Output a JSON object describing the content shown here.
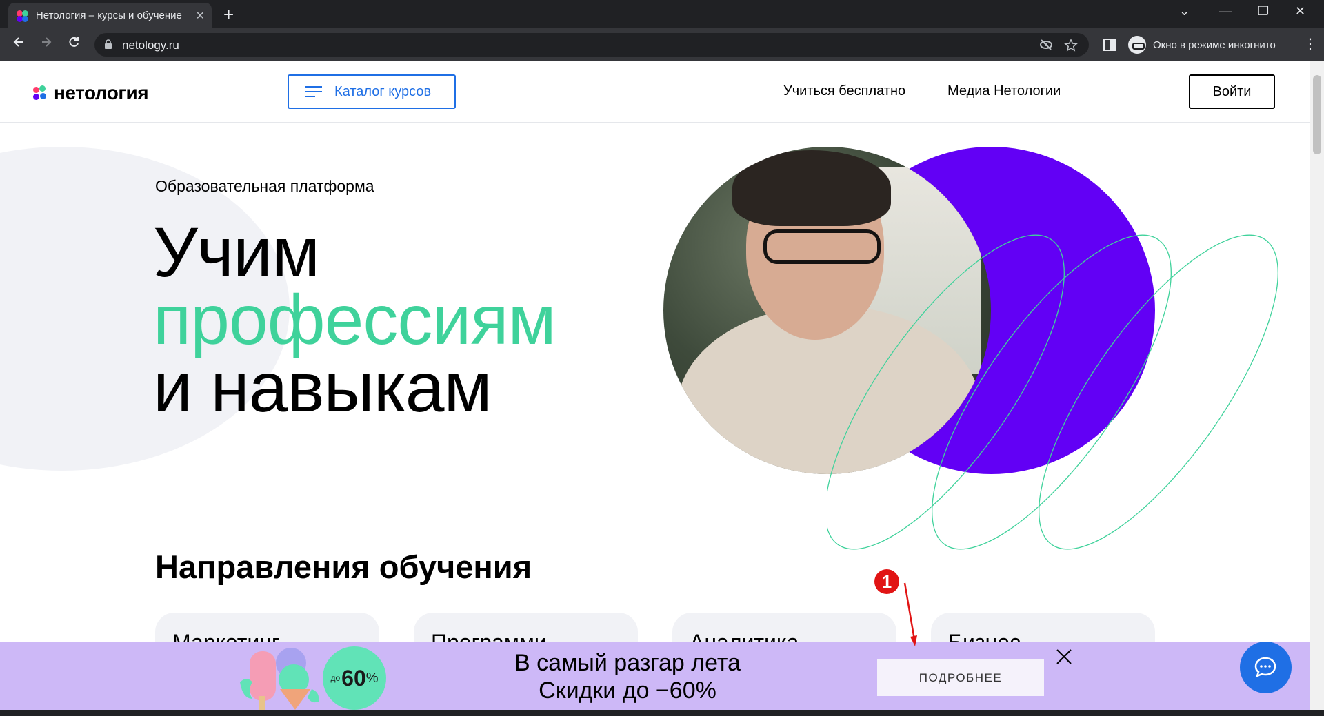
{
  "browser": {
    "tab_title": "Нетология – курсы и обучение",
    "tab_close": "✕",
    "new_tab": "+",
    "url": "netology.ru",
    "incognito_label": "Окно в режиме инкогнито",
    "window_controls": [
      "⌄",
      "—",
      "❐",
      "✕"
    ]
  },
  "header": {
    "logo_text": "нетология",
    "catalog_label": "Каталог курсов",
    "nav": [
      "Учиться бесплатно",
      "Медиа Нетологии"
    ],
    "login_label": "Войти"
  },
  "hero": {
    "kicker": "Образовательная платформа",
    "line1": "Учим",
    "line2": "профессиям",
    "line3": "и навыкам"
  },
  "directions": {
    "title": "Направления обучения",
    "cards": [
      "Маркетинг",
      "Программи",
      "Аналитика",
      "Бизнес"
    ]
  },
  "promo": {
    "badge_prefix": "до",
    "badge_value": "60",
    "badge_suffix": "%",
    "line1": "В самый разгар лета",
    "line2": "Скидки до −60%",
    "more_label": "ПОДРОБНЕЕ"
  },
  "annotation": {
    "number": "1"
  },
  "colors": {
    "brand_blue": "#1f6fe5",
    "brand_green": "#3fd29b",
    "brand_purple": "#6200f5",
    "promo_bg": "#cdb8f7"
  },
  "icons": [
    "back-icon",
    "forward-icon",
    "reload-icon",
    "lock-icon",
    "eye-off-icon",
    "star-icon",
    "side-panel-icon",
    "incognito-icon",
    "menu-icon",
    "chat-icon",
    "close-icon"
  ]
}
